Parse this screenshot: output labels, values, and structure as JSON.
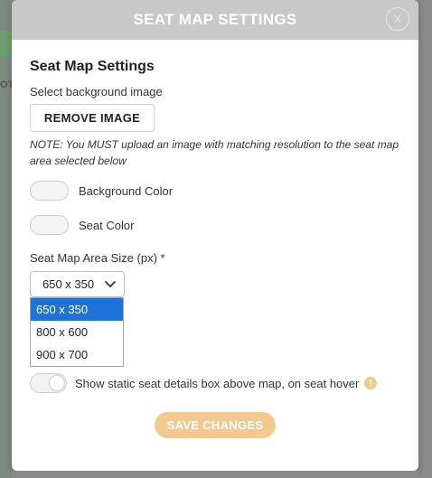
{
  "modal": {
    "header_title": "SEAT MAP SETTINGS",
    "close_label": "X",
    "section_title": "Seat Map Settings",
    "background_image_label": "Select background image",
    "remove_image_label": "REMOVE IMAGE",
    "note": "NOTE: You MUST upload an image with matching resolution to the seat map area selected below",
    "background_color_label": "Background Color",
    "seat_color_label": "Seat Color",
    "area_size_label": "Seat Map Area Size (px) *",
    "area_size_selected": "650 x 350",
    "area_size_options": [
      "650 x 350",
      "800 x 600",
      "900 x 700"
    ],
    "static_details_label": "Show static seat details box above map, on seat hover",
    "info_icon_glyph": "!",
    "save_label": "SAVE CHANGES"
  },
  "backdrop": {
    "partial_text": "OT"
  },
  "colors": {
    "header_bg": "#c8c8c8",
    "accent_orange": "#f3c990",
    "selected_option": "#1e73d8",
    "backdrop": "#8a8a8a"
  }
}
